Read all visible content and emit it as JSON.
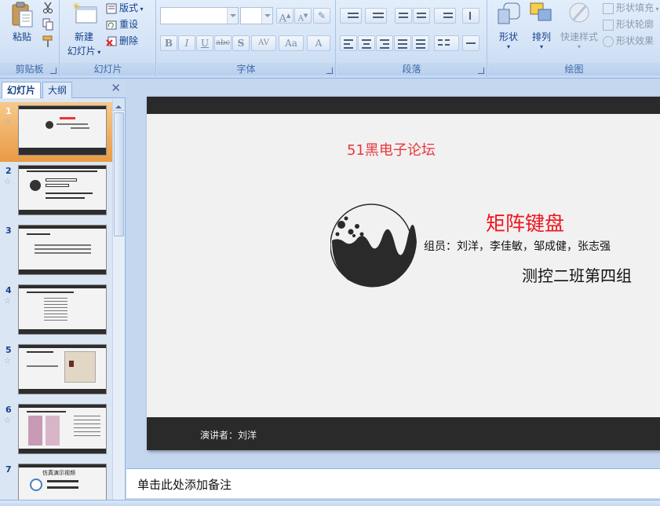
{
  "ribbon": {
    "clipboard": {
      "label": "剪贴板",
      "paste": "粘贴"
    },
    "slides": {
      "label": "幻灯片",
      "new_slide_line1": "新建",
      "new_slide_line2": "幻灯片",
      "layout": "版式",
      "reset": "重设",
      "delete": "删除"
    },
    "font": {
      "label": "字体",
      "bold": "B",
      "italic": "I",
      "underline": "U",
      "strike": "abc",
      "shadow": "S",
      "spacing": "AV",
      "case": "Aa",
      "color": "A",
      "grow": "A",
      "shrink": "A"
    },
    "paragraph": {
      "label": "段落"
    },
    "drawing": {
      "label": "绘图",
      "shapes": "形状",
      "arrange": "排列",
      "quick_styles": "快速样式",
      "shape_fill": "形状填充",
      "shape_outline": "形状轮廓",
      "shape_effects": "形状效果"
    }
  },
  "left_pane": {
    "tab_slides": "幻灯片",
    "tab_outline": "大纲",
    "close": "✕",
    "thumbnails": [
      {
        "num": "1",
        "selected": true
      },
      {
        "num": "2",
        "selected": false
      },
      {
        "num": "3",
        "selected": false
      },
      {
        "num": "4",
        "selected": false
      },
      {
        "num": "5",
        "selected": false
      },
      {
        "num": "6",
        "selected": false
      },
      {
        "num": "7",
        "selected": false
      }
    ],
    "thumb7_title": "仿真演示视频"
  },
  "slide": {
    "forum": "51黑电子论坛",
    "title": "矩阵键盘",
    "members": "组员：刘洋，李佳敏，邹成健，张志强",
    "class": "测控二班第四组",
    "presenter": "演讲者：刘洋"
  },
  "notes": {
    "placeholder": "单击此处添加备注"
  },
  "colors": {
    "accent_red": "#f0141e",
    "forum_red": "#e8383d",
    "slide_bar": "#2a2a2a",
    "selection": "#e99a44"
  }
}
